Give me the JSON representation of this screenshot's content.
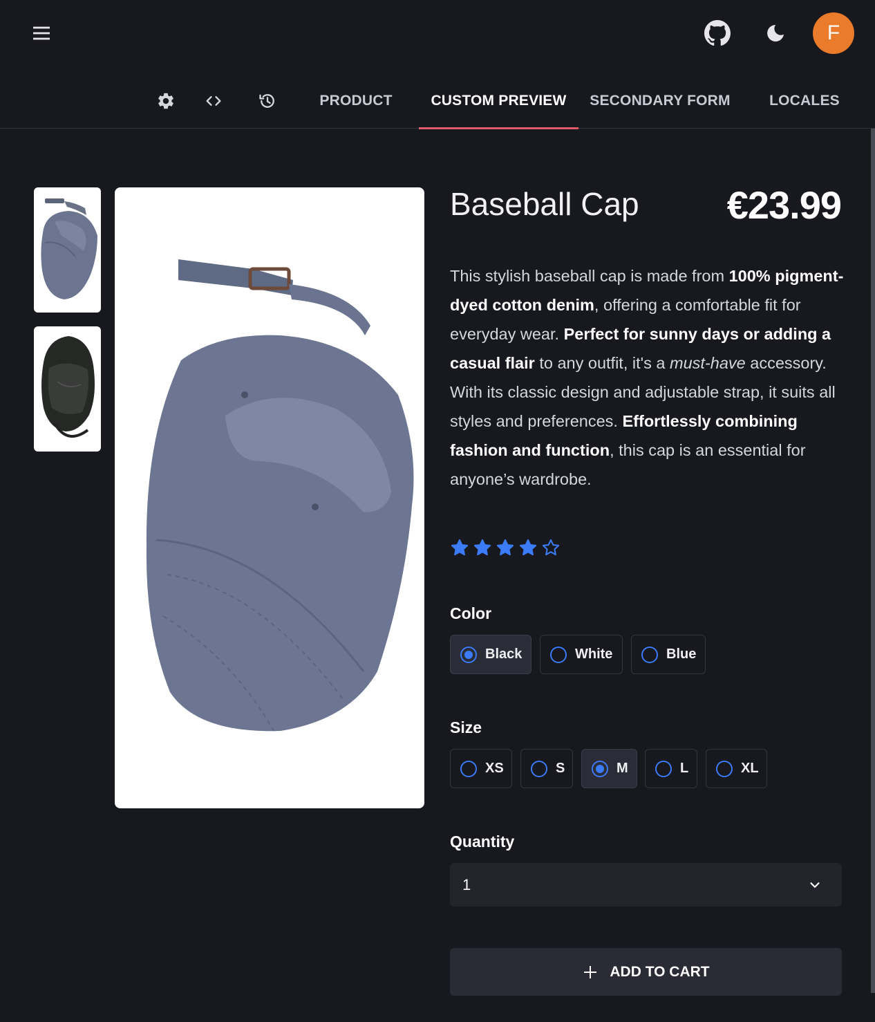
{
  "appbar": {
    "icons": [
      "menu-icon",
      "github-icon",
      "moon-icon"
    ],
    "avatar_initial": "F",
    "avatar_color": "#e97b2b"
  },
  "tabs": {
    "tool_icons": [
      "settings-icon",
      "code-icon",
      "history-icon"
    ],
    "items": [
      {
        "label": "PRODUCT"
      },
      {
        "label": "CUSTOM PREVIEW"
      },
      {
        "label": "SECONDARY FORM"
      },
      {
        "label": "LOCALES"
      }
    ],
    "active": "CUSTOM PREVIEW",
    "accent": "#e05a6a"
  },
  "product": {
    "title": "Baseball Cap",
    "price": "€23.99",
    "description": [
      {
        "text": "This stylish baseball cap is made from ",
        "style": "normal"
      },
      {
        "text": "100% pigment-dyed cotton denim",
        "style": "bold"
      },
      {
        "text": ", offering a comfortable fit for everyday wear. ",
        "style": "normal"
      },
      {
        "text": "Perfect for sunny days or adding a casual flair",
        "style": "bold"
      },
      {
        "text": " to any outfit, it's a ",
        "style": "normal"
      },
      {
        "text": "must-have",
        "style": "italic"
      },
      {
        "text": " accessory. With its classic design and adjustable strap, it suits all styles and preferences. ",
        "style": "normal"
      },
      {
        "text": "Effortlessly combining fashion and function",
        "style": "bold"
      },
      {
        "text": ", this cap is an essential for anyone’s wardrobe.",
        "style": "normal"
      }
    ],
    "rating": 4,
    "rating_max": 5,
    "star_color": "#3b7bf6",
    "images": [
      "grey-blue cap front",
      "black cap"
    ]
  },
  "color": {
    "label": "Color",
    "options": [
      "Black",
      "White",
      "Blue"
    ],
    "selected": "Black"
  },
  "size": {
    "label": "Size",
    "options": [
      "XS",
      "S",
      "M",
      "L",
      "XL"
    ],
    "selected": "M"
  },
  "quantity": {
    "label": "Quantity",
    "value": "1"
  },
  "cart": {
    "label": "ADD TO CART"
  }
}
